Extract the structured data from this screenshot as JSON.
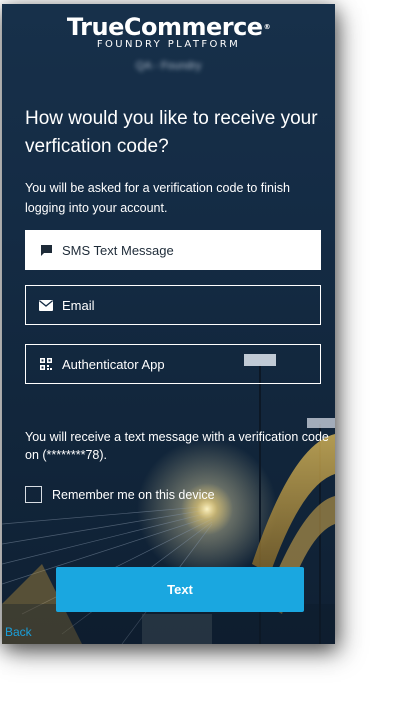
{
  "brand": {
    "name": "TrueCommerce",
    "trademark": "®",
    "subtitle": "FOUNDRY PLATFORM",
    "tenant": "QA - Foundry"
  },
  "heading": "How would you like to receive your verfication code?",
  "subtext": "You will be asked for a verification code to finish logging into your account.",
  "options": [
    {
      "label": "SMS Text Message",
      "icon": "chat-bubble-icon",
      "selected": true
    },
    {
      "label": "Email",
      "icon": "envelope-icon",
      "selected": false
    },
    {
      "label": "Authenticator App",
      "icon": "qr-code-icon",
      "selected": false
    }
  ],
  "info_text": "You will receive a text message with a verification code on (********78).",
  "remember_label": "Remember me on this device",
  "submit_label": "Text",
  "back_label": "Back",
  "colors": {
    "background": "#142b44",
    "accent_button": "#1aa7e0",
    "back_link": "#1a9fdb",
    "selected_option_bg": "#ffffff"
  }
}
